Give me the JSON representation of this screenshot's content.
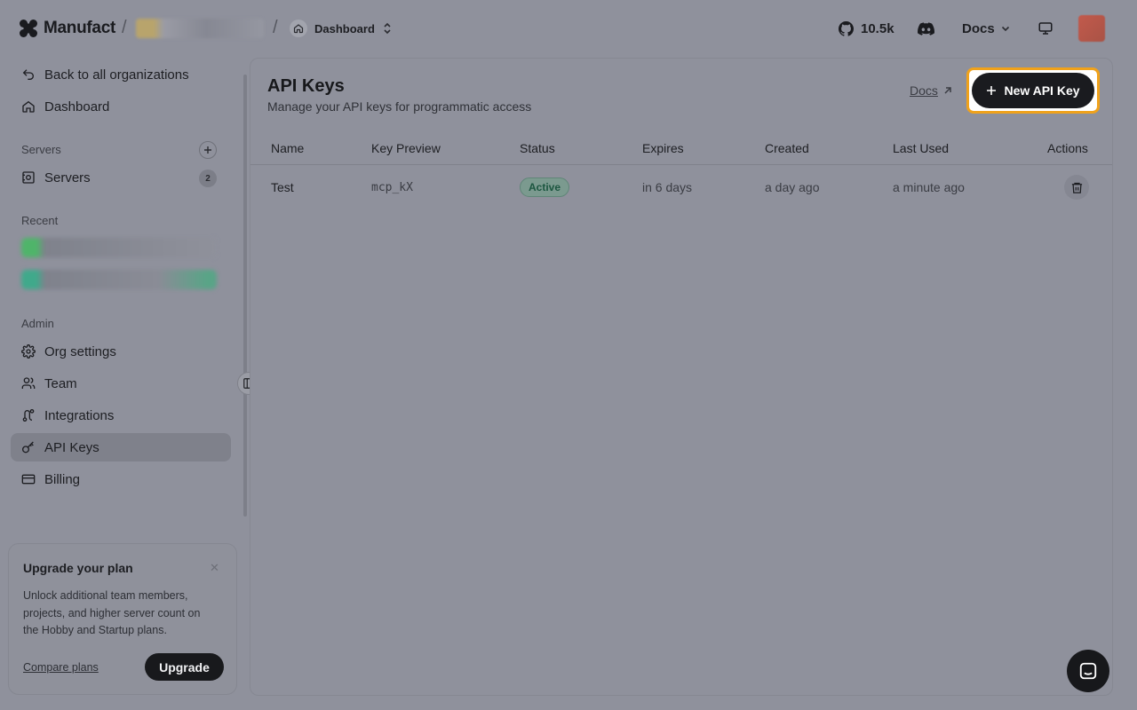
{
  "header": {
    "brand": "Manufact",
    "separator": "/",
    "crumb_label": "Dashboard",
    "github_count": "10.5k",
    "docs_menu_label": "Docs"
  },
  "sidebar": {
    "back_label": "Back to all organizations",
    "dashboard_label": "Dashboard",
    "servers_section": "Servers",
    "servers_item": "Servers",
    "servers_count": "2",
    "recent_section": "Recent",
    "admin_section": "Admin",
    "admin_items": [
      {
        "label": "Org settings",
        "icon": "gear-icon"
      },
      {
        "label": "Team",
        "icon": "users-icon"
      },
      {
        "label": "Integrations",
        "icon": "route-icon"
      },
      {
        "label": "API Keys",
        "icon": "key-icon",
        "active": true
      },
      {
        "label": "Billing",
        "icon": "credit-card-icon"
      }
    ]
  },
  "upgrade": {
    "title": "Upgrade your plan",
    "close": "✕",
    "body": "Unlock additional team members, projects, and higher server count on the Hobby and Startup plans.",
    "compare_label": "Compare plans",
    "button_label": "Upgrade"
  },
  "main": {
    "title": "API Keys",
    "subtitle": "Manage your API keys for programmatic access",
    "docs_link": "Docs",
    "new_key_label": "New API Key",
    "columns": [
      "Name",
      "Key Preview",
      "Status",
      "Expires",
      "Created",
      "Last Used",
      "Actions"
    ],
    "rows": [
      {
        "name": "Test",
        "key_preview": "mcp_kX",
        "status": "Active",
        "expires": "in 6 days",
        "created": "a day ago",
        "last_used": "a minute ago"
      }
    ]
  },
  "colors": {
    "highlight": "#f0a21b",
    "primary_button": "#1a1b1f",
    "status_active": "#1c5640"
  }
}
